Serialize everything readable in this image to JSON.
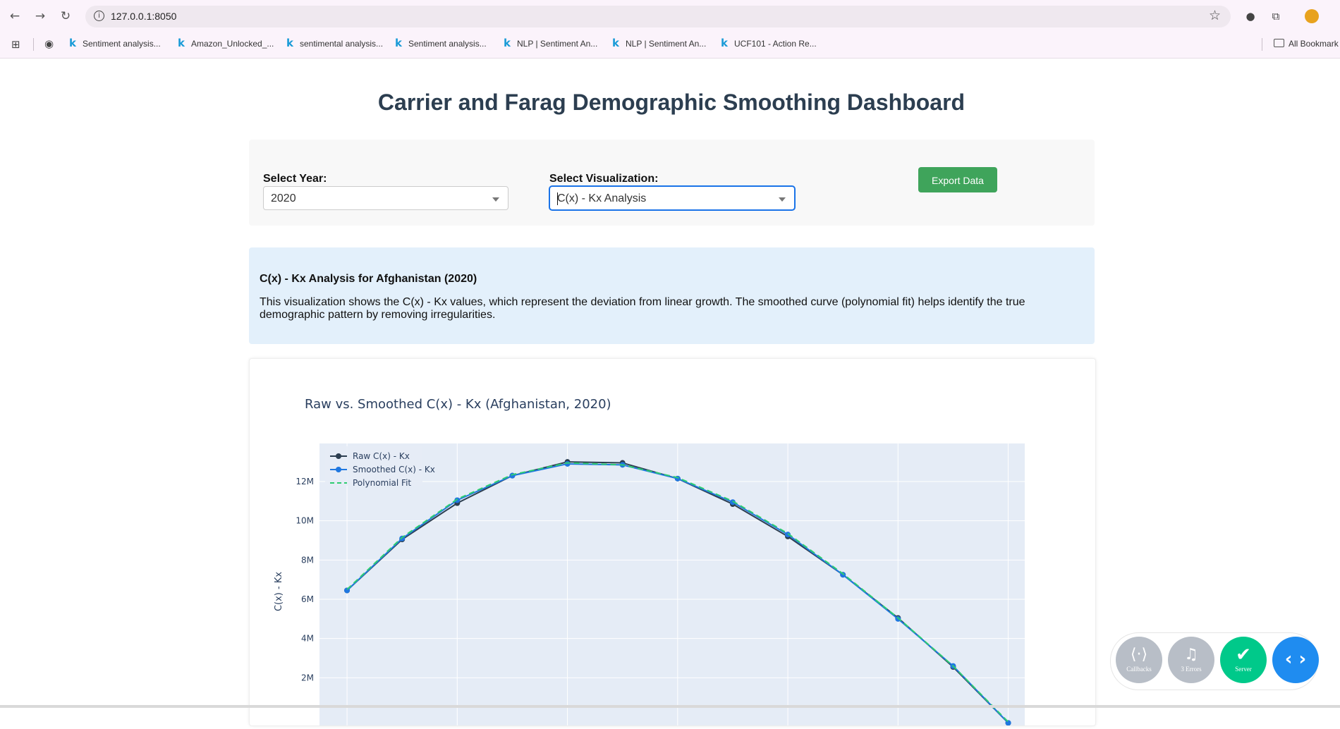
{
  "browser": {
    "url": "127.0.0.1:8050",
    "bookmarks": [
      "Sentiment analysis...",
      "Amazon_Unlocked_...",
      "sentimental analysis...",
      "Sentiment analysis...",
      "NLP | Sentiment An...",
      "NLP | Sentiment An...",
      "UCF101 - Action Re..."
    ],
    "all_bookmarks": "All Bookmark"
  },
  "page": {
    "title": "Carrier and Farag Demographic Smoothing Dashboard"
  },
  "controls": {
    "year_label": "Select Year:",
    "year_value": "2020",
    "viz_label": "Select Visualization:",
    "viz_value": "C(x) - Kx Analysis",
    "export_label": "Export Data"
  },
  "info": {
    "heading": "C(x) - Kx Analysis for Afghanistan (2020)",
    "text": "This visualization shows the C(x) - Kx values, which represent the deviation from linear growth. The smoothed curve (polynomial fit) helps identify the true demographic pattern by removing irregularities."
  },
  "chart_data": {
    "type": "line",
    "title": "Raw vs. Smoothed C(x) - Kx (Afghanistan, 2020)",
    "ylabel": "C(x) - Kx",
    "xlabel": "",
    "x": [
      0,
      1,
      2,
      3,
      4,
      5,
      6,
      7,
      8,
      9,
      10,
      11,
      12
    ],
    "series": [
      {
        "name": "Raw C(x) - Kx",
        "color": "#2c3e50",
        "dash": "solid",
        "markers": true,
        "values": [
          6.45,
          9.05,
          10.9,
          12.3,
          13.0,
          12.95,
          12.15,
          10.85,
          9.2,
          7.25,
          5.05,
          2.55,
          -0.3
        ]
      },
      {
        "name": "Smoothed C(x) - Kx",
        "color": "#1f77e0",
        "dash": "solid",
        "markers": true,
        "values": [
          6.45,
          9.1,
          11.05,
          12.3,
          12.9,
          12.85,
          12.15,
          10.95,
          9.3,
          7.25,
          5.0,
          2.6,
          -0.3
        ]
      },
      {
        "name": "Polynomial Fit",
        "color": "#2ecc71",
        "dash": "dash",
        "markers": false,
        "values": [
          6.5,
          9.15,
          11.1,
          12.35,
          12.95,
          12.85,
          12.2,
          11.0,
          9.35,
          7.3,
          5.05,
          2.6,
          -0.25
        ]
      }
    ],
    "yticks": [
      "2M",
      "4M",
      "6M",
      "8M",
      "10M",
      "12M"
    ],
    "ytick_values": [
      2,
      4,
      6,
      8,
      10,
      12
    ],
    "ylim": [
      0,
      14
    ],
    "xlim": [
      -0.5,
      12.3
    ],
    "grid": true,
    "legend": "top-left"
  },
  "devtools": {
    "callbacks": "Callbacks",
    "errors": "3 Errors",
    "server": "Server"
  },
  "colors": {
    "title": "#2c3e50",
    "export_button": "#3fa45b",
    "info_bg": "#e3f0fb",
    "plot_bg": "#e5ecf6",
    "devtools_gray": "#b8bec7",
    "devtools_green": "#00c98a",
    "devtools_blue": "#1f8cf0"
  }
}
